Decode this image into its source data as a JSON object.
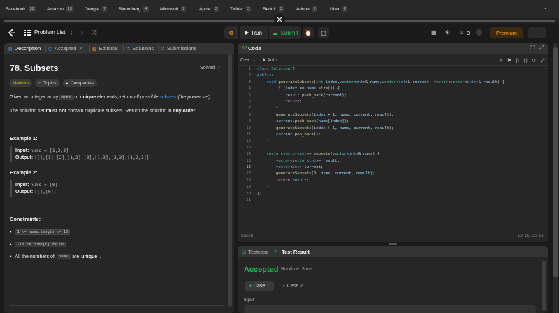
{
  "company_bar": {
    "companies": [
      {
        "name": "Facebook",
        "count": "38"
      },
      {
        "name": "Amazon",
        "count": "13"
      },
      {
        "name": "Google",
        "count": "7"
      },
      {
        "name": "Bloomberg",
        "count": "4"
      },
      {
        "name": "Microsoft",
        "count": "2"
      },
      {
        "name": "Apple",
        "count": "3"
      },
      {
        "name": "Twitter",
        "count": "3"
      },
      {
        "name": "Reddit",
        "count": "3"
      },
      {
        "name": "Adobe",
        "count": "2"
      },
      {
        "name": "Uber",
        "count": "2"
      }
    ],
    "close_glyph": "✕",
    "chevron_glyph": "⌄"
  },
  "navbar": {
    "problem_list_label": "Problem List",
    "run_label": "Run",
    "submit_label": "Submit",
    "streak_count": "0",
    "premium_label": "Premium",
    "accent_color": "#ffa116",
    "submit_color": "#2cbb5d"
  },
  "left_tabs": {
    "description": "Description",
    "accepted": "Accepted",
    "editorial": "Editorial",
    "solutions": "Solutions",
    "submissions": "Submissions"
  },
  "problem": {
    "title": "78. Subsets",
    "status": "Solved",
    "difficulty": "Medium",
    "topics_label": "Topics",
    "companies_label": "Companies",
    "desc_1_pre": "Given an integer array",
    "desc_1_code": "nums",
    "desc_1_mid": "of",
    "desc_1_bold": "unique",
    "desc_1_post": "elements, return",
    "desc_1_italic": "all possible",
    "desc_1_link": "subsets",
    "desc_1_end": "(the power set).",
    "desc_2_pre": "The solution set",
    "desc_2_bold": "must not",
    "desc_2_mid": "contain duplicate subsets. Return the solution in",
    "desc_2_bold2": "any order",
    "desc_2_end": ".",
    "examples": [
      {
        "title": "Example 1:",
        "input_label": "Input:",
        "input": "nums = [1,2,3]",
        "output_label": "Output:",
        "output": "[[],[1],[2],[1,2],[3],[1,3],[2,3],[1,2,3]]"
      },
      {
        "title": "Example 2:",
        "input_label": "Input:",
        "input": "nums = [0]",
        "output_label": "Output:",
        "output": "[[],[0]]"
      }
    ],
    "constraints_title": "Constraints:",
    "constraints": [
      "1 <= nums.length <= 10",
      "-10 <= nums[i] <= 10"
    ],
    "constraint_3_pre": "All the numbers of",
    "constraint_3_code": "nums",
    "constraint_3_mid": "are",
    "constraint_3_bold": "unique",
    "constraint_3_end": "."
  },
  "code_panel": {
    "title": "Code",
    "language": "C++",
    "auto_label": "Auto",
    "saved_label": "Saved",
    "cursor_pos": "Ln 16, Col 16",
    "active_line": 16,
    "lines": [
      "class Solution {",
      "public:",
      "    void generateSubsets(int index,vector<int>& nums,vector<int>& current, vector<vector<int>>& result) {",
      "        if (index == nums.size()) {",
      "            result.push_back(current);",
      "            return;",
      "        }",
      "        generateSubsets(index + 1, nums, current, result);",
      "        current.push_back(nums[index]);",
      "        generateSubsets(index + 1, nums, current, result);",
      "        current.pop_back();",
      "    }",
      "",
      "    vector<vector<int>> subsets(vector<int>& nums) {",
      "        vector<vector<int>> result;",
      "        vector<int> current;",
      "        generateSubsets(0, nums, current, result);",
      "        return result;",
      "    }",
      "};",
      ""
    ]
  },
  "test_panel": {
    "testcase_tab": "Testcase",
    "result_tab": "Test Result",
    "verdict": "Accepted",
    "runtime": "Runtime: 3 ms",
    "case_1": "Case 1",
    "case_2": "Case 2",
    "input_label": "Input",
    "verdict_color": "#2cbb5d"
  }
}
